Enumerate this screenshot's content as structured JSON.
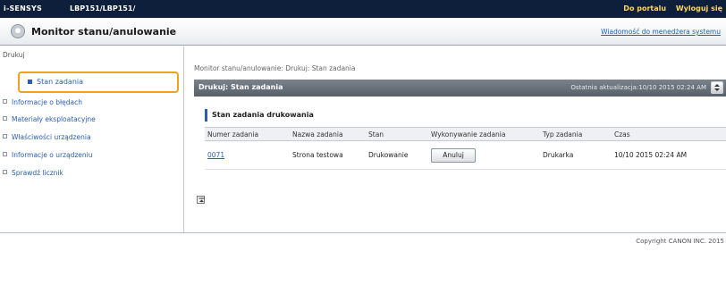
{
  "topbar": {
    "brand": "i-SENSYS",
    "model": "LBP151/LBP151/",
    "portal_link": "Do portalu",
    "logout_link": "Wyloguj się"
  },
  "header": {
    "title": "Monitor stanu/anulowanie",
    "manager_link": "Wiadomość do menedżera systemu"
  },
  "sidebar": {
    "section": "Drukuj",
    "active_item": "Stan zadania",
    "items": [
      {
        "label": "Informacje o błędach"
      },
      {
        "label": "Materiały eksploatacyjne"
      },
      {
        "label": "Właściwości urządzenia"
      },
      {
        "label": "Informacje o urządzeniu"
      },
      {
        "label": "Sprawdź licznik"
      }
    ]
  },
  "content": {
    "breadcrumb": "Monitor stanu/anulowanie: Drukuj: Stan zadania",
    "section_title": "Drukuj: Stan zadania",
    "last_updated": "Ostatnia aktualizacja:10/10 2015 02:24 AM",
    "jobs_title": "Stan zadania drukowania",
    "columns": [
      "Numer zadania",
      "Nazwa zadania",
      "Stan",
      "Wykonywanie zadania",
      "Typ zadania",
      "Czas"
    ],
    "rows": [
      {
        "number": "0071",
        "name": "Strona testowa",
        "status": "Drukowanie",
        "action": "Anuluj",
        "type": "Drukarka",
        "time": "10/10 2015 02:24 AM"
      }
    ]
  },
  "footer": {
    "copyright": "Copyright CANON INC. 2015"
  },
  "colors": {
    "topbar": "#0d1f3a",
    "link": "#2a5db0",
    "highlight": "#f0a21f",
    "section_bar": "#575f68"
  }
}
